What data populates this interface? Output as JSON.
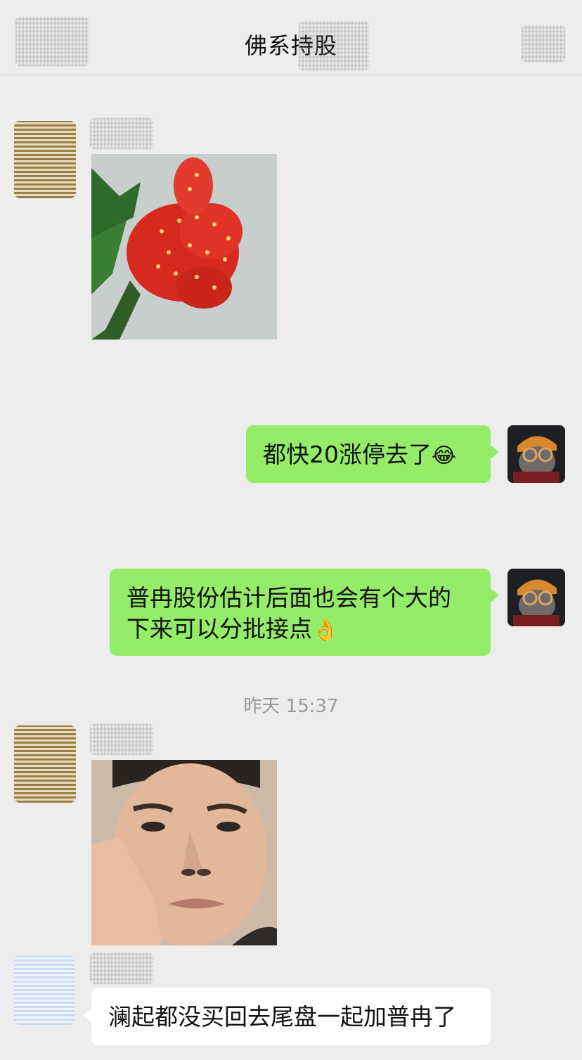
{
  "header": {
    "title": "佛系持股",
    "back_icon": "back-icon",
    "more_icon": "more-icon"
  },
  "messages": [
    {
      "side": "left",
      "type": "sticker",
      "sticker": "strawberry-thumbs-up"
    },
    {
      "side": "right",
      "type": "text",
      "text": "都快20涨停去了",
      "emoji": "😂"
    },
    {
      "side": "right",
      "type": "text",
      "text": "普冉股份估计后面也会有个大的下来可以分批接点",
      "emoji": "👌"
    },
    {
      "type": "timestamp",
      "text": "昨天 15:37"
    },
    {
      "side": "left",
      "type": "sticker",
      "sticker": "man-hand-on-cheek"
    },
    {
      "side": "left",
      "type": "text",
      "text": "澜起都没买回去尾盘一起加普冉了"
    }
  ],
  "colors": {
    "background": "#ededed",
    "bubble_self": "#95ec69",
    "bubble_other": "#ffffff",
    "timestamp": "#9a9a9a"
  }
}
